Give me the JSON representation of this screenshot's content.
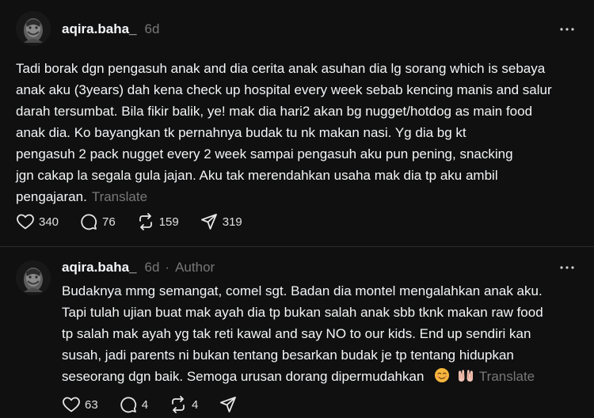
{
  "posts": [
    {
      "username": "aqira.baha_",
      "time": "6d",
      "author_tag": "",
      "body_lines": [
        "Tadi borak dgn pengasuh anak and dia cerita anak asuhan dia lg sorang which is sebaya",
        "anak aku (3years) dah kena check up hospital every week sebab kencing manis and salur",
        "darah tersumbat. Bila fikir balik, ye! mak dia hari2 akan bg nugget/hotdog as main food",
        "anak dia. Ko bayangkan tk pernahnya budak tu nk makan nasi. Yg dia bg kt",
        "pengasuh 2 pack nugget every 2 week sampai pengasuh aku pun pening, snacking",
        "jgn cakap la segala gula jajan. Aku tak merendahkan usaha mak dia tp aku ambil",
        "pengajaran."
      ],
      "translate_label": "Translate",
      "likes": "340",
      "replies": "76",
      "reposts": "159",
      "shares": "319"
    },
    {
      "username": "aqira.baha_",
      "time": "6d",
      "separator": "·",
      "author_tag": "Author",
      "body_lines": [
        "Budaknya mmg semangat, comel sgt. Badan dia montel mengalahkan anak aku.",
        "Tapi tulah ujian buat mak ayah dia tp bukan salah anak sbb tknk makan raw food",
        "tp salah mak ayah yg tak reti kawal and say NO to our kids. End up sendiri kan",
        "susah, jadi parents ni bukan tentang besarkan budak je tp tentang hidupkan",
        "seseorang dgn baik. Semoga urusan dorang dipermudahkan"
      ],
      "emojis": [
        "relieved-face-emoji",
        "palms-up-together-emoji"
      ],
      "translate_label": "Translate",
      "likes": "63",
      "replies": "4",
      "reposts": "4",
      "shares": ""
    }
  ],
  "icons": {
    "like": "heart-icon",
    "reply": "comment-icon",
    "repost": "repost-icon",
    "share": "send-icon",
    "more": "more-icon"
  },
  "colors": {
    "background": "#101010",
    "text": "#f3f5f7",
    "secondary": "#777777",
    "divider": "#2b2b2b"
  }
}
